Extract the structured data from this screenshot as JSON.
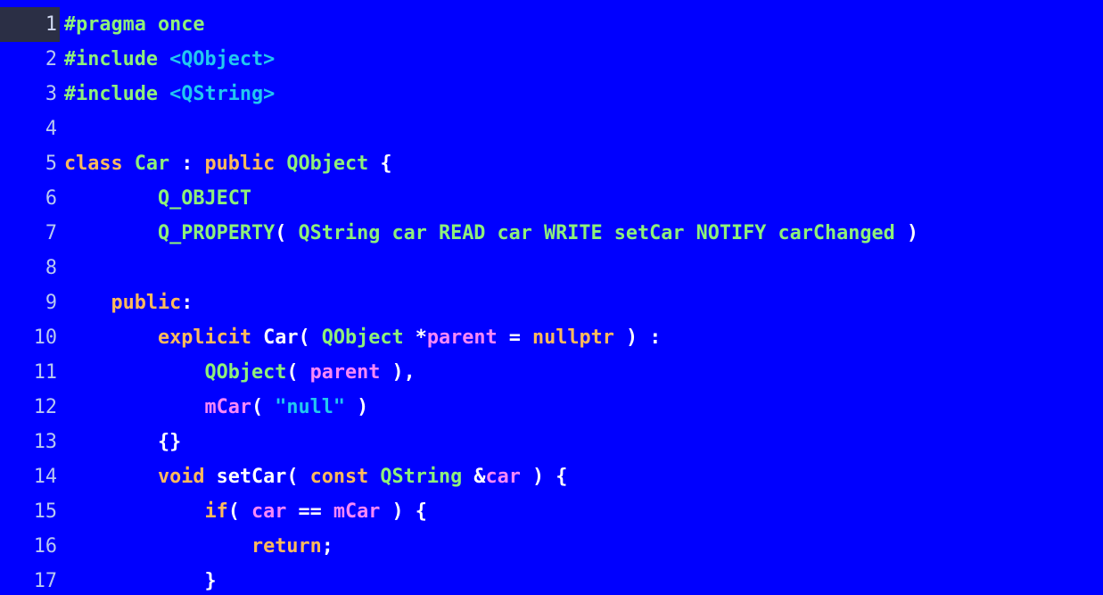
{
  "editor": {
    "active_line": 1,
    "colors": {
      "background": "#0000ff",
      "line_number": "#b8c8f0",
      "active_gutter": "#2b2f45",
      "green": "#8ef07a",
      "cyan": "#22c8f0",
      "orange": "#ffba5c",
      "pink": "#f888f8",
      "white": "#ffffff"
    },
    "lines": [
      {
        "num": "1",
        "tokens": [
          {
            "t": "#pragma once",
            "c": "green"
          }
        ]
      },
      {
        "num": "2",
        "tokens": [
          {
            "t": "#include ",
            "c": "green"
          },
          {
            "t": "<QObject>",
            "c": "cyan"
          }
        ]
      },
      {
        "num": "3",
        "tokens": [
          {
            "t": "#include ",
            "c": "green"
          },
          {
            "t": "<QString>",
            "c": "cyan"
          }
        ]
      },
      {
        "num": "4",
        "tokens": []
      },
      {
        "num": "5",
        "tokens": [
          {
            "t": "class ",
            "c": "orange"
          },
          {
            "t": "Car",
            "c": "green"
          },
          {
            "t": " : ",
            "c": "white"
          },
          {
            "t": "public ",
            "c": "orange"
          },
          {
            "t": "QObject",
            "c": "green"
          },
          {
            "t": " {",
            "c": "white"
          }
        ]
      },
      {
        "num": "6",
        "tokens": [
          {
            "t": "        ",
            "c": "white"
          },
          {
            "t": "Q_OBJECT",
            "c": "green"
          }
        ]
      },
      {
        "num": "7",
        "tokens": [
          {
            "t": "        ",
            "c": "white"
          },
          {
            "t": "Q_PROPERTY",
            "c": "green"
          },
          {
            "t": "( ",
            "c": "white"
          },
          {
            "t": "QString car READ car WRITE setCar NOTIFY carChanged",
            "c": "green"
          },
          {
            "t": " )",
            "c": "white"
          }
        ]
      },
      {
        "num": "8",
        "tokens": []
      },
      {
        "num": "9",
        "tokens": [
          {
            "t": "    ",
            "c": "white"
          },
          {
            "t": "public",
            "c": "orange"
          },
          {
            "t": ":",
            "c": "white"
          }
        ]
      },
      {
        "num": "10",
        "tokens": [
          {
            "t": "        ",
            "c": "white"
          },
          {
            "t": "explicit ",
            "c": "orange"
          },
          {
            "t": "Car",
            "c": "white"
          },
          {
            "t": "( ",
            "c": "white"
          },
          {
            "t": "QObject",
            "c": "green"
          },
          {
            "t": " *",
            "c": "white"
          },
          {
            "t": "parent",
            "c": "pink"
          },
          {
            "t": " = ",
            "c": "white"
          },
          {
            "t": "nullptr",
            "c": "orange"
          },
          {
            "t": " ) :",
            "c": "white"
          }
        ]
      },
      {
        "num": "11",
        "tokens": [
          {
            "t": "            ",
            "c": "white"
          },
          {
            "t": "QObject",
            "c": "green"
          },
          {
            "t": "( ",
            "c": "white"
          },
          {
            "t": "parent",
            "c": "pink"
          },
          {
            "t": " ),",
            "c": "white"
          }
        ]
      },
      {
        "num": "12",
        "tokens": [
          {
            "t": "            ",
            "c": "white"
          },
          {
            "t": "mCar",
            "c": "pink"
          },
          {
            "t": "( ",
            "c": "white"
          },
          {
            "t": "\"null\"",
            "c": "cyan"
          },
          {
            "t": " )",
            "c": "white"
          }
        ]
      },
      {
        "num": "13",
        "tokens": [
          {
            "t": "        ",
            "c": "white"
          },
          {
            "t": "{}",
            "c": "white"
          }
        ]
      },
      {
        "num": "14",
        "tokens": [
          {
            "t": "        ",
            "c": "white"
          },
          {
            "t": "void ",
            "c": "orange"
          },
          {
            "t": "setCar",
            "c": "white"
          },
          {
            "t": "( ",
            "c": "white"
          },
          {
            "t": "const ",
            "c": "orange"
          },
          {
            "t": "QString",
            "c": "green"
          },
          {
            "t": " &",
            "c": "white"
          },
          {
            "t": "car",
            "c": "pink"
          },
          {
            "t": " ) {",
            "c": "white"
          }
        ]
      },
      {
        "num": "15",
        "tokens": [
          {
            "t": "            ",
            "c": "white"
          },
          {
            "t": "if",
            "c": "orange"
          },
          {
            "t": "( ",
            "c": "white"
          },
          {
            "t": "car",
            "c": "pink"
          },
          {
            "t": " == ",
            "c": "white"
          },
          {
            "t": "mCar",
            "c": "pink"
          },
          {
            "t": " ) {",
            "c": "white"
          }
        ]
      },
      {
        "num": "16",
        "tokens": [
          {
            "t": "                ",
            "c": "white"
          },
          {
            "t": "return",
            "c": "orange"
          },
          {
            "t": ";",
            "c": "white"
          }
        ]
      },
      {
        "num": "17",
        "tokens": [
          {
            "t": "            ",
            "c": "white"
          },
          {
            "t": "}",
            "c": "white"
          }
        ]
      }
    ]
  }
}
